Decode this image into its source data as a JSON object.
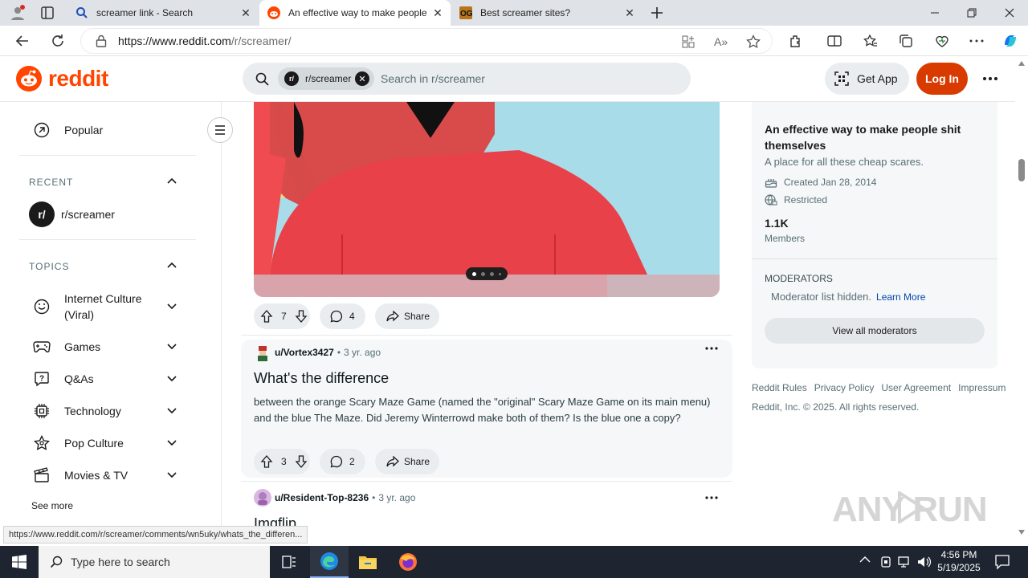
{
  "browser": {
    "tabs": [
      {
        "title": "screamer link - Search",
        "active": false
      },
      {
        "title": "An effective way to make people",
        "active": true
      },
      {
        "title": "Best screamer sites?",
        "active": false
      }
    ],
    "url_host": "https://www.reddit.com",
    "url_path": "/r/screamer/"
  },
  "reddit": {
    "logo_text": "reddit",
    "search_chip": "r/screamer",
    "search_chip_avatar": "r/",
    "search_placeholder": "Search in r/screamer",
    "get_app_label": "Get App",
    "login_label": "Log In"
  },
  "leftnav": {
    "popular": "Popular",
    "recent_heading": "RECENT",
    "recent_item": "r/screamer",
    "recent_avatar": "r/",
    "topics_heading": "TOPICS",
    "topics": [
      {
        "label": "Internet Culture (Viral)",
        "icon": "smiley-icon"
      },
      {
        "label": "Games",
        "icon": "gamepad-icon"
      },
      {
        "label": "Q&As",
        "icon": "question-icon"
      },
      {
        "label": "Technology",
        "icon": "chip-icon"
      },
      {
        "label": "Pop Culture",
        "icon": "star-icon"
      },
      {
        "label": "Movies & TV",
        "icon": "clapper-icon"
      }
    ],
    "see_more": "See more"
  },
  "feed": {
    "post1": {
      "upvotes": "7",
      "comments": "4",
      "share": "Share"
    },
    "post2": {
      "author": "u/Vortex3427",
      "age": "3 yr. ago",
      "title": "What's the difference",
      "body": "between the orange Scary Maze Game (named the \"original\" Scary Maze Game on its main menu) and the blue The Maze. Did Jeremy Winterrowd make both of them? Is the blue one a copy?",
      "upvotes": "3",
      "comments": "2",
      "share": "Share"
    },
    "post3": {
      "author": "u/Resident-Top-8236",
      "age": "3 yr. ago",
      "title": "Imgflip"
    }
  },
  "sidebar": {
    "title": "An effective way to make people shit themselves",
    "description": "A place for all these cheap scares.",
    "created": "Created Jan 28, 2014",
    "restricted": "Restricted",
    "members_count": "1.1K",
    "members_label": "Members",
    "moderators_heading": "MODERATORS",
    "moderators_hidden": "Moderator list hidden.",
    "learn_more": "Learn More",
    "view_all_mods": "View all moderators",
    "footer_links": [
      "Reddit Rules",
      "Privacy Policy",
      "User Agreement",
      "Impressum"
    ],
    "copyright": "Reddit, Inc. © 2025. All rights reserved."
  },
  "status_link": "https://www.reddit.com/r/screamer/comments/wn5uky/whats_the_differen...",
  "taskbar": {
    "search_placeholder": "Type here to search",
    "time": "4:56 PM",
    "date": "5/19/2025"
  },
  "watermark": "ANY RUN",
  "colors": {
    "brand_orange": "#ff4500",
    "login_bg": "#d93a00",
    "link_blue": "#0045ac"
  }
}
